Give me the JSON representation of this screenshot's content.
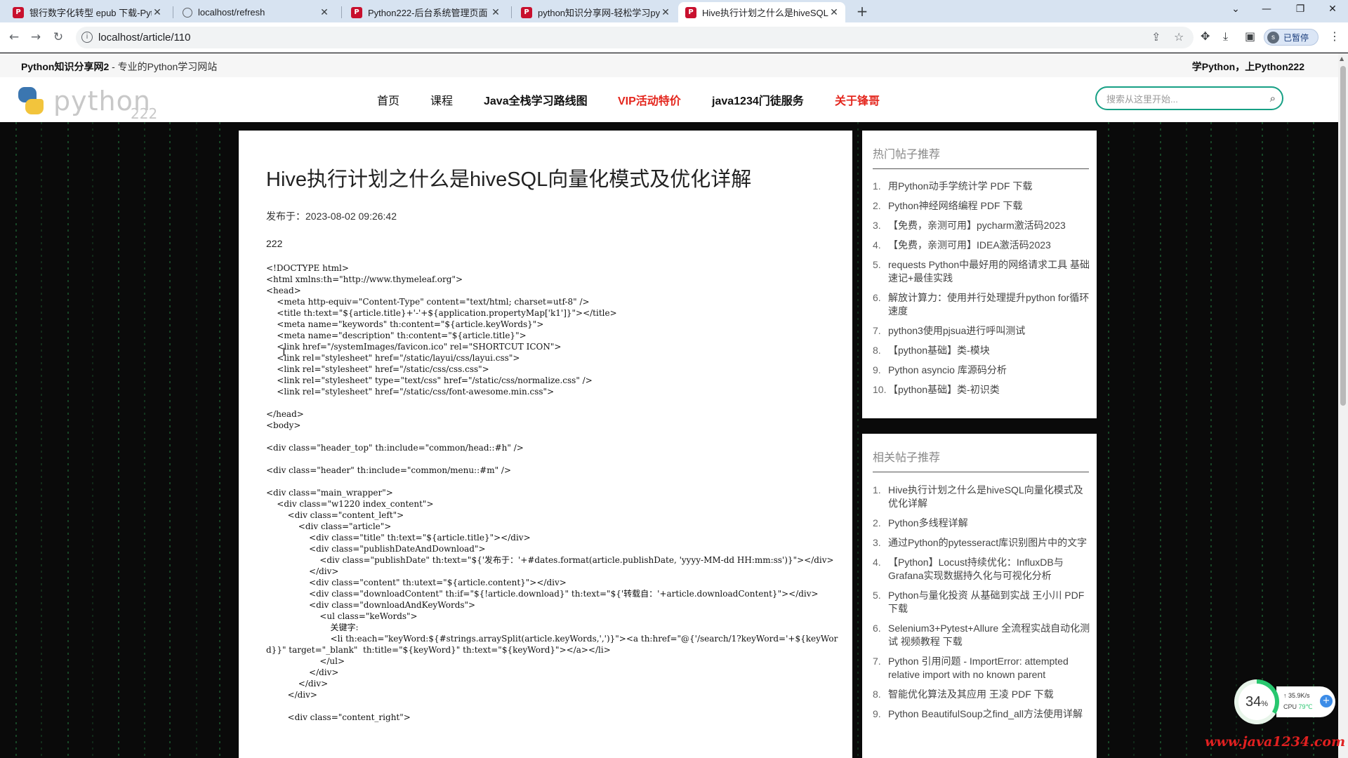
{
  "browser": {
    "tabs": [
      {
        "title": "银行数字化转型 epub 下载-Pyth",
        "favicon": "p-icon"
      },
      {
        "title": "localhost/refresh",
        "favicon": "globe-icon"
      },
      {
        "title": "Python222-后台系统管理页面",
        "favicon": "p-icon"
      },
      {
        "title": "python知识分享网-轻松学习pyt",
        "favicon": "p-icon"
      },
      {
        "title": "Hive执行计划之什么是hiveSQL",
        "favicon": "p-icon",
        "active": true
      }
    ],
    "new_tab": "+",
    "url": "localhost/article/110",
    "profile_initial": "s",
    "profile_label": "已暂停"
  },
  "site": {
    "top_left_bold": "Python知识分享网2",
    "top_left_rest": " - 专业的Python学习网站",
    "top_right": "学Python，上Python222",
    "logo_word": "python",
    "logo_version": "222",
    "nav": [
      {
        "label": "首页"
      },
      {
        "label": "课程"
      },
      {
        "label": "Java全栈学习路线图"
      },
      {
        "label": "VIP活动特价"
      },
      {
        "label": "java1234门徒服务"
      },
      {
        "label": "关于锋哥"
      }
    ],
    "search_placeholder": "搜索从这里开始..."
  },
  "article": {
    "title": "Hive执行计划之什么是hiveSQL向量化模式及优化详解",
    "published": "发布于：2023-08-02 09:26:42",
    "body": "222",
    "code": "<!DOCTYPE html>\n<html xmlns:th=\"http://www.thymeleaf.org\">\n<head>\n    <meta http-equiv=\"Content-Type\" content=\"text/html; charset=utf-8\" />\n    <title th:text=\"${article.title}+'-'+${application.propertyMap['k1']}\"></title>\n    <meta name=\"keywords\" th:content=\"${article.keyWords}\">\n    <meta name=\"description\" th:content=\"${article.title}\">\n    <link href=\"/systemImages/favicon.ico\" rel=\"SHORTCUT ICON\">\n    <link rel=\"stylesheet\" href=\"/static/layui/css/layui.css\">\n    <link rel=\"stylesheet\" href=\"/static/css/css.css\">\n    <link rel=\"stylesheet\" type=\"text/css\" href=\"/static/css/normalize.css\" />\n    <link rel=\"stylesheet\" href=\"/static/css/font-awesome.min.css\">\n\n</head>\n<body>\n\n<div class=\"header_top\" th:include=\"common/head::#h\" />\n\n<div class=\"header\" th:include=\"common/menu::#m\" />\n\n<div class=\"main_wrapper\">\n    <div class=\"w1220 index_content\">\n        <div class=\"content_left\">\n            <div class=\"article\">\n                <div class=\"title\" th:text=\"${article.title}\"></div>\n                <div class=\"publishDateAndDownload\">\n                    <div class=\"publishDate\" th:text=\"${'发布于：'+#dates.format(article.publishDate, 'yyyy-MM-dd HH:mm:ss')}\"></div>\n                </div>\n                <div class=\"content\" th:utext=\"${article.content}\"></div>\n                <div class=\"downloadContent\" th:if=\"${!article.download}\" th:text=\"${'转载自：'+article.downloadContent}\"></div>\n                <div class=\"downloadAndKeyWords\">\n                    <ul class=\"keWords\">\n                        关键字:\n                        <li th:each=\"keyWord:${#strings.arraySplit(article.keyWords,',')}\"><a th:href=\"@{'/search/1?keyWord='+${keyWord}}\" target=\"_blank\"  th:title=\"${keyWord}\" th:text=\"${keyWord}\"></a></li>\n                    </ul>\n                </div>\n            </div>\n        </div>\n\n        <div class=\"content_right\">"
  },
  "hot_posts": {
    "heading": "热门帖子推荐",
    "items": [
      {
        "n": "1.",
        "t": "用Python动手学统计学 PDF 下载"
      },
      {
        "n": "2.",
        "t": "Python神经网络编程 PDF 下载"
      },
      {
        "n": "3.",
        "t": "【免费，亲测可用】pycharm激活码2023"
      },
      {
        "n": "4.",
        "t": "【免费，亲测可用】IDEA激活码2023"
      },
      {
        "n": "5.",
        "t": "requests Python中最好用的网络请求工具 基础速记+最佳实践"
      },
      {
        "n": "6.",
        "t": "解放计算力：使用并行处理提升python for循环速度"
      },
      {
        "n": "7.",
        "t": "python3使用pjsua进行呼叫测试"
      },
      {
        "n": "8.",
        "t": "【python基础】类-模块"
      },
      {
        "n": "9.",
        "t": "Python asyncio 库源码分析"
      },
      {
        "n": "10.",
        "t": "【python基础】类-初识类"
      }
    ]
  },
  "related_posts": {
    "heading": "相关帖子推荐",
    "items": [
      {
        "n": "1.",
        "t": "Hive执行计划之什么是hiveSQL向量化模式及优化详解"
      },
      {
        "n": "2.",
        "t": "Python多线程详解"
      },
      {
        "n": "3.",
        "t": "通过Python的pytesseract库识别图片中的文字"
      },
      {
        "n": "4.",
        "t": "【Python】Locust持续优化：InfluxDB与Grafana实现数据持久化与可视化分析"
      },
      {
        "n": "5.",
        "t": "Python与量化投资 从基础到实战 王小川 PDF 下载"
      },
      {
        "n": "6.",
        "t": "Selenium3+Pytest+Allure 全流程实战自动化测试 视频教程 下载"
      },
      {
        "n": "7.",
        "t": "Python 引用问题 - ImportError: attempted relative import with no known parent"
      },
      {
        "n": "8.",
        "t": "智能优化算法及其应用 王凌 PDF 下载"
      },
      {
        "n": "9.",
        "t": "Python BeautifulSoup之find_all方法使用详解"
      }
    ]
  },
  "monitor": {
    "cpu_percent": "34",
    "percent_sign": "%",
    "net_speed": "↑ 35.9K/s",
    "cpu_label": "CPU",
    "cpu_temp": "79℃",
    "plus": "+"
  },
  "watermark": "www.java1234.com",
  "colors": {
    "accent_red": "#e4261d",
    "search_border": "#17a085",
    "monitor_green": "#28c76f"
  }
}
